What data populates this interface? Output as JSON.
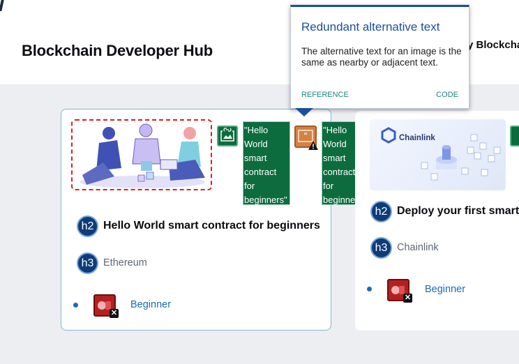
{
  "header": {
    "title": "Blockchain Developer Hub",
    "clipped_title": "y Blockchain"
  },
  "tooltip": {
    "title": "Redundant alternative text",
    "body": "The alternative text for an image is the same as nearby or adjacent text.",
    "reference_label": "REFERENCE",
    "code_label": "CODE"
  },
  "cards": [
    {
      "alt_text": "\"Hello World smart contract for beginners\"",
      "alt_text_2": "\"Hello World smart contract for beginners\"",
      "h2_badge": "h2",
      "h2": "Hello World smart contract for beginners",
      "h3_badge": "h3",
      "h3": "Ethereum",
      "level": "Beginner"
    },
    {
      "logo_text": "Chainlink",
      "h2_badge": "h2",
      "h2": "Deploy your first smart",
      "h3_badge": "h3",
      "h3": "Chainlink",
      "level": "Beginner"
    }
  ],
  "colors": {
    "accent": "#1a4f9c",
    "alt_badge": "#0c6c3d",
    "error": "#e11d1d",
    "link": "#1b6cb5"
  },
  "icons": [
    "link-icon",
    "image-icon",
    "quote-icon",
    "warning-icon",
    "x-icon",
    "chainlink-logo-icon"
  ]
}
